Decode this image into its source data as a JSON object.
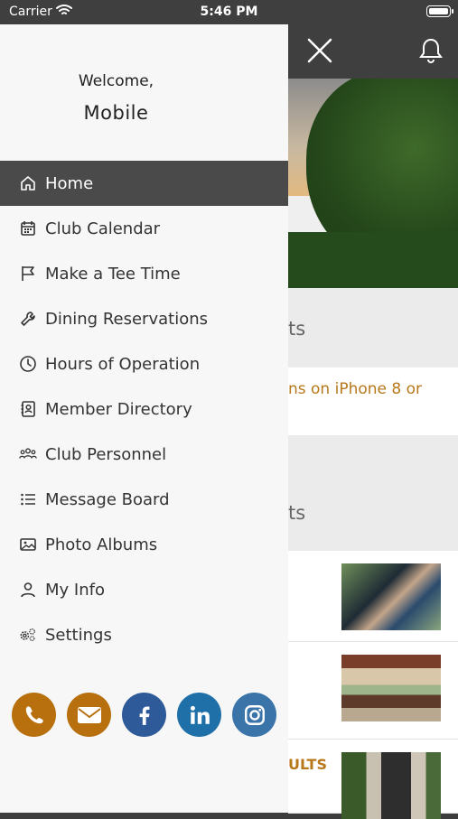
{
  "status_bar": {
    "carrier": "Carrier",
    "time": "5:46 PM"
  },
  "background_app": {
    "section1_heading_partial": "ts",
    "alert_partial": "ns on iPhone 8 or",
    "section2_heading_partial": "ts",
    "news_partial_title": "ULTS"
  },
  "drawer": {
    "welcome": "Welcome,",
    "username": "Mobile",
    "menu": [
      {
        "label": "Home",
        "icon": "home-icon",
        "active": true
      },
      {
        "label": "Club Calendar",
        "icon": "calendar-icon"
      },
      {
        "label": "Make a Tee Time",
        "icon": "flag-icon"
      },
      {
        "label": "Dining Reservations",
        "icon": "wrench-icon"
      },
      {
        "label": "Hours of Operation",
        "icon": "clock-icon"
      },
      {
        "label": "Member Directory",
        "icon": "contact-book-icon"
      },
      {
        "label": "Club Personnel",
        "icon": "group-icon"
      },
      {
        "label": "Message Board",
        "icon": "list-icon"
      },
      {
        "label": "Photo Albums",
        "icon": "image-icon"
      },
      {
        "label": "My Info",
        "icon": "user-icon"
      },
      {
        "label": "Settings",
        "icon": "gears-icon"
      }
    ],
    "social": [
      {
        "name": "phone-icon",
        "color": "#b8700f"
      },
      {
        "name": "email-icon",
        "color": "#b8700f"
      },
      {
        "name": "facebook-icon",
        "color": "#2f5a9a"
      },
      {
        "name": "linkedin-icon",
        "color": "#1f6fa8"
      },
      {
        "name": "instagram-icon",
        "color": "#3a74a8"
      }
    ]
  },
  "colors": {
    "accent_gold": "#b8781a",
    "header_dark": "#3f3f3f",
    "active_row": "#4a4a4a"
  }
}
